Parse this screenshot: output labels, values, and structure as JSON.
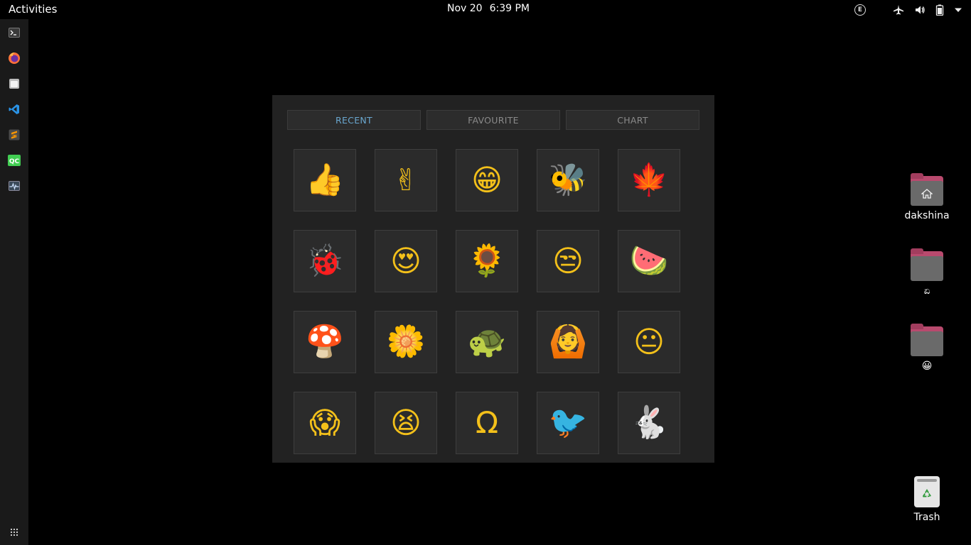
{
  "topbar": {
    "activities": "Activities",
    "date": "Nov 20",
    "time": "6:39 PM",
    "ime_label": "E"
  },
  "dock": {
    "items": [
      "terminal-icon",
      "firefox-icon",
      "files-icon",
      "vscode-icon",
      "sublime-text-icon",
      "qt-creator-icon",
      "system-monitor-icon"
    ],
    "show_apps": "show-apps-icon"
  },
  "panel": {
    "tabs": [
      {
        "label": "RECENT",
        "active": true
      },
      {
        "label": "FAVOURITE",
        "active": false
      },
      {
        "label": "CHART",
        "active": false
      }
    ],
    "grid": [
      [
        "👍",
        "✌",
        "😁",
        "🐝",
        "🍁"
      ],
      [
        "🐞",
        "😍",
        "🌻",
        "😒",
        "🍉"
      ],
      [
        "🍄",
        "🌼",
        "🐢",
        "🙆",
        "😐"
      ],
      [
        "😱",
        "😫",
        "Ω",
        "🐦",
        "🐇"
      ]
    ],
    "accent_color": "#f3c01a",
    "active_tab_color": "#6aa7cf"
  },
  "desktop": {
    "home_label": "dakshina",
    "folder2_label": "ಏ",
    "folder3_label": "😀",
    "trash_label": "Trash"
  }
}
